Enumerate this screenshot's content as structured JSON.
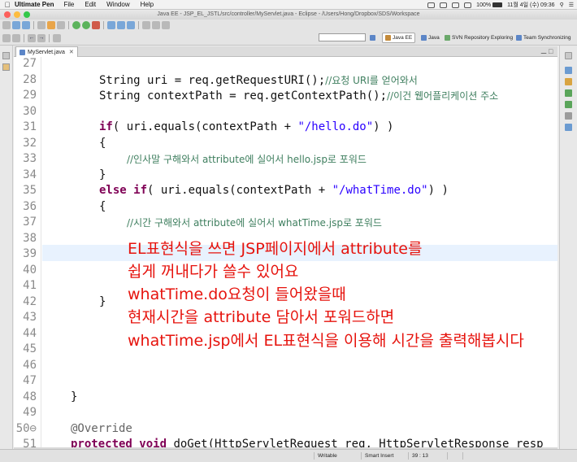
{
  "menubar": {
    "app_name": "Ultimate Pen",
    "items": [
      "File",
      "Edit",
      "Window",
      "Help"
    ],
    "battery": "100%",
    "datetime": "11월 4일 (수)  09:36"
  },
  "window": {
    "title": "Java EE - JSP_EL_JSTL/src/controller/MyServlet.java - Eclipse - /Users/Hong/Dropbox/SDS/Workspace"
  },
  "perspectives": [
    "Java EE",
    "Java",
    "SVN Repository Exploring",
    "Team Synchronizing"
  ],
  "editor": {
    "tab_label": "MyServlet.java",
    "tab_close": "✕",
    "line_numbers": [
      "27",
      "28",
      "29",
      "30",
      "31",
      "32",
      "33",
      "34",
      "35",
      "36",
      "37",
      "38",
      "39",
      "40",
      "41",
      "42",
      "43",
      "44",
      "45",
      "46",
      "47",
      "48",
      "49",
      "50⊖",
      "51"
    ],
    "code": {
      "l28_a": "String uri = req.getRequestURI();",
      "l28_c": "//요청 URI를 얻어와서",
      "l29_a": "String contextPath = req.getContextPath();",
      "l29_c": "//이건 웹어플리케이션 주소",
      "l31_kw": "if",
      "l31_a": "( uri.equals(contextPath + ",
      "l31_s": "\"/hello.do\"",
      "l31_b": ") )",
      "l32": "{",
      "l33_c": "//인사말 구해와서 attribute에 실어서 hello.jsp로 포워드",
      "l34": "}",
      "l35_kw1": "else",
      "l35_kw2": "if",
      "l35_a": "( uri.equals(contextPath + ",
      "l35_s": "\"/whatTime.do\"",
      "l35_b": ") )",
      "l36": "{",
      "l37_c": "//시간 구해와서 attribute에 실어서 whatTime.jsp로 포워드",
      "l42": "}",
      "l48": "}",
      "l50": "@Override",
      "l51_kw": "protected void",
      "l51_a": " doGet(HttpServletRequest req, HttpServletResponse resp"
    }
  },
  "annotation_text": [
    "EL표현식을 쓰면 JSP페이지에서 attribute를",
    "쉽게 꺼내다가 쓸수 있어요",
    "whatTime.do요청이 들어왔을때",
    "현재시간을 attribute 담아서 포워드하면",
    "whatTime.jsp에서 EL표현식을 이용해 시간을 출력해봅시다"
  ],
  "statusbar": {
    "mode": "Writable",
    "insert": "Smart Insert",
    "position": "39 : 13"
  },
  "colors": {
    "annotation": "#e6130d",
    "keyword": "#7f0055",
    "comment": "#3f7f5f",
    "string": "#2a00ff",
    "current_line": "#e8f2fe"
  }
}
